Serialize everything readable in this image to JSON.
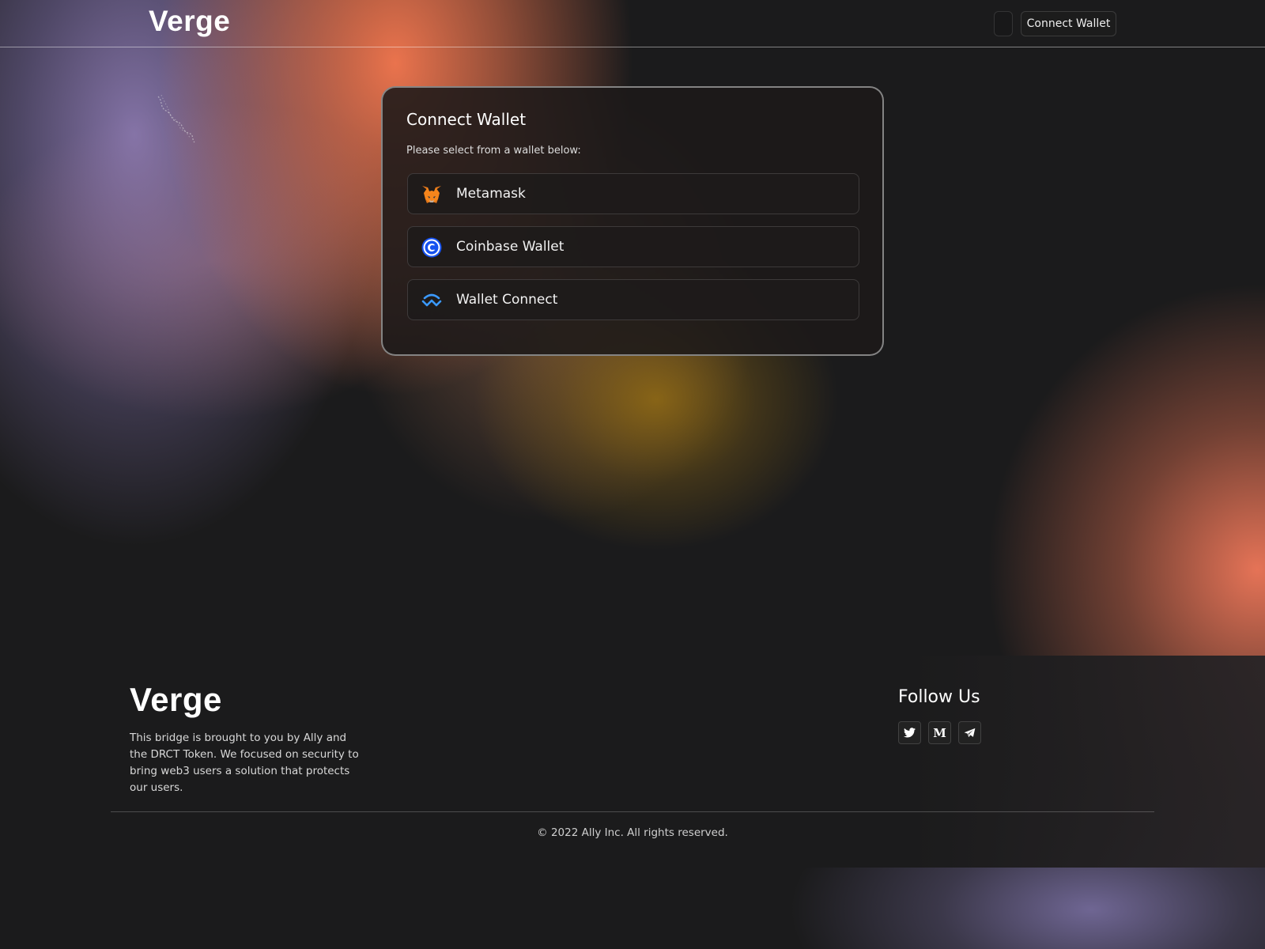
{
  "header": {
    "logo": "Verge",
    "connect_wallet_label": "Connect Wallet"
  },
  "modal": {
    "title": "Connect Wallet",
    "subtitle": "Please select from a wallet below:",
    "wallets": [
      {
        "label": "Metamask",
        "icon": "metamask-fox-icon"
      },
      {
        "label": "Coinbase Wallet",
        "icon": "coinbase-icon"
      },
      {
        "label": "Wallet Connect",
        "icon": "walletconnect-icon"
      }
    ]
  },
  "footer": {
    "logo": "Verge",
    "description": "This bridge is brought to you by Ally and the DRCT Token. We focused on security to bring web3 users a solution that protects our users.",
    "follow_title": "Follow Us",
    "socials": [
      {
        "name": "twitter",
        "icon": "twitter-icon"
      },
      {
        "name": "medium",
        "icon": "medium-icon",
        "glyph": "M"
      },
      {
        "name": "telegram",
        "icon": "telegram-icon"
      }
    ],
    "copyright": "© 2022 Ally Inc. All rights reserved."
  },
  "colors": {
    "background": "#1b1b1c",
    "accent_orange": "#f5784f",
    "accent_lavender": "#9682be",
    "coinbase_blue": "#1652f0",
    "walletconnect_blue": "#3b99fc"
  }
}
